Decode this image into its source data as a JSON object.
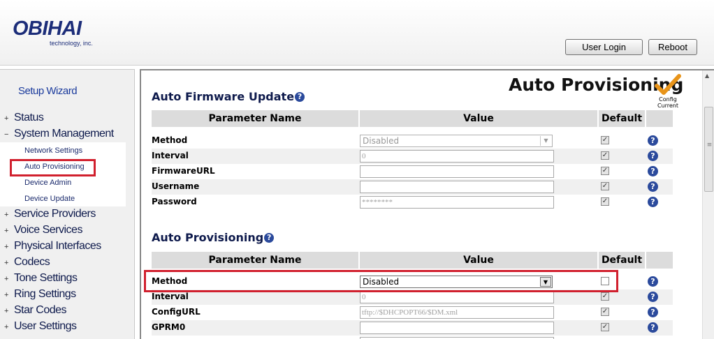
{
  "header": {
    "brand": "OBIHAI",
    "brand_sub": "technology, inc.",
    "login_label": "User Login",
    "reboot_label": "Reboot"
  },
  "sidebar": {
    "wizard": "Setup Wizard",
    "sections": [
      {
        "label": "Status",
        "expander": "+"
      },
      {
        "label": "System Management",
        "expander": "−"
      },
      {
        "label": "Service Providers",
        "expander": "+"
      },
      {
        "label": "Voice Services",
        "expander": "+"
      },
      {
        "label": "Physical Interfaces",
        "expander": "+"
      },
      {
        "label": "Codecs",
        "expander": "+"
      },
      {
        "label": "Tone Settings",
        "expander": "+"
      },
      {
        "label": "Ring Settings",
        "expander": "+"
      },
      {
        "label": "Star Codes",
        "expander": "+"
      },
      {
        "label": "User Settings",
        "expander": "+"
      }
    ],
    "subitems": [
      "Network Settings",
      "Auto Provisioning",
      "Device Admin",
      "Device Update"
    ]
  },
  "main": {
    "title": "Auto Provisioning",
    "config_label_1": "Config",
    "config_label_2": "Current",
    "columns": {
      "param": "Parameter Name",
      "value": "Value",
      "default": "Default"
    },
    "firmware": {
      "title": "Auto Firmware Update",
      "rows": [
        {
          "label": "Method",
          "value": "Disabled"
        },
        {
          "label": "Interval",
          "value": "0"
        },
        {
          "label": "FirmwareURL",
          "value": ""
        },
        {
          "label": "Username",
          "value": ""
        },
        {
          "label": "Password",
          "value": "********"
        }
      ]
    },
    "provisioning": {
      "title": "Auto Provisioning",
      "rows": [
        {
          "label": "Method",
          "value": "Disabled"
        },
        {
          "label": "Interval",
          "value": "0"
        },
        {
          "label": "ConfigURL",
          "value": "tftp://$DHCPOPT66/$DM.xml"
        },
        {
          "label": "GPRM0",
          "value": ""
        }
      ]
    }
  },
  "colors": {
    "accent": "#1c2d79",
    "highlight": "#d1202e",
    "check": "#e8941a"
  }
}
